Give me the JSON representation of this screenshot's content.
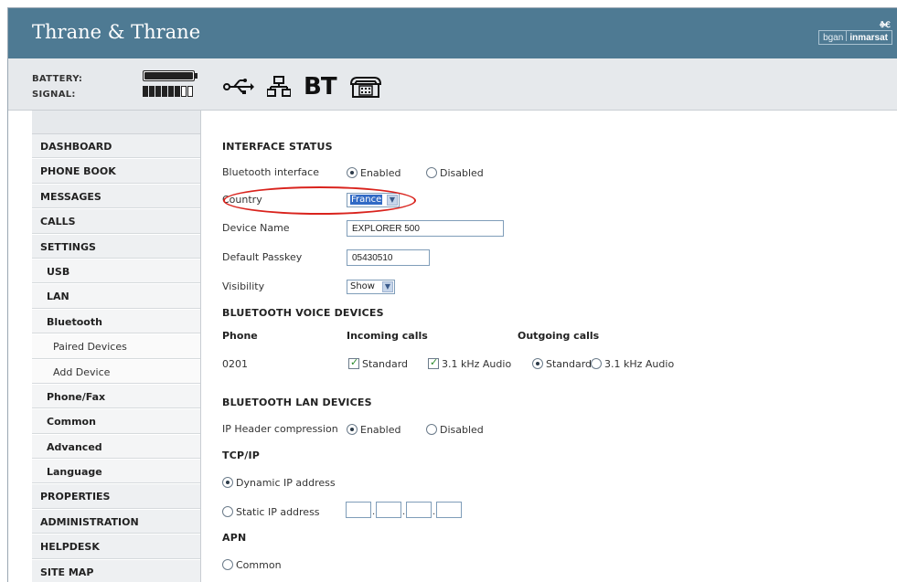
{
  "header": {
    "brand": "Thrane & Thrane",
    "logo_left": "bgan",
    "logo_right": "inmarsat"
  },
  "status": {
    "battery_label": "BATTERY:",
    "signal_label": "SIGNAL:",
    "battery_level": 1.0,
    "signal_bars_on": 6,
    "signal_bars_total": 8
  },
  "interface_icons": [
    "usb-icon",
    "lan-icon",
    "bluetooth-icon",
    "phone-fax-icon"
  ],
  "bt_text": "BT",
  "nav": {
    "items": [
      {
        "label": "DASHBOARD",
        "level": 0
      },
      {
        "label": "PHONE BOOK",
        "level": 0
      },
      {
        "label": "MESSAGES",
        "level": 0
      },
      {
        "label": "CALLS",
        "level": 0
      },
      {
        "label": "SETTINGS",
        "level": 0
      },
      {
        "label": "USB",
        "level": 1
      },
      {
        "label": "LAN",
        "level": 1
      },
      {
        "label": "Bluetooth",
        "level": 1
      },
      {
        "label": "Paired Devices",
        "level": 2
      },
      {
        "label": "Add Device",
        "level": 2
      },
      {
        "label": "Phone/Fax",
        "level": 1
      },
      {
        "label": "Common",
        "level": 1
      },
      {
        "label": "Advanced",
        "level": 1
      },
      {
        "label": "Language",
        "level": 1
      },
      {
        "label": "PROPERTIES",
        "level": 0
      },
      {
        "label": "ADMINISTRATION",
        "level": 0
      },
      {
        "label": "HELPDESK",
        "level": 0
      },
      {
        "label": "SITE MAP",
        "level": 0
      }
    ]
  },
  "interface_status": {
    "title": "INTERFACE STATUS",
    "bt_interface_label": "Bluetooth interface",
    "enabled": "Enabled",
    "disabled": "Disabled",
    "country_label": "Country",
    "country_value": "France",
    "device_name_label": "Device Name",
    "device_name_value": "EXPLORER 500",
    "passkey_label": "Default Passkey",
    "passkey_value": "05430510",
    "visibility_label": "Visibility",
    "visibility_value": "Show"
  },
  "voice_devices": {
    "title": "BLUETOOTH VOICE DEVICES",
    "col_phone": "Phone",
    "col_incoming": "Incoming calls",
    "col_outgoing": "Outgoing calls",
    "phone": "0201",
    "standard": "Standard",
    "audio": "3.1 kHz Audio"
  },
  "lan_devices": {
    "title": "BLUETOOTH LAN DEVICES",
    "ip_header_label": "IP Header compression",
    "enabled": "Enabled",
    "disabled": "Disabled"
  },
  "tcpip": {
    "title": "TCP/IP",
    "dynamic": "Dynamic IP address",
    "static": "Static IP address",
    "ip_dot": "."
  },
  "apn": {
    "title": "APN",
    "common": "Common"
  }
}
